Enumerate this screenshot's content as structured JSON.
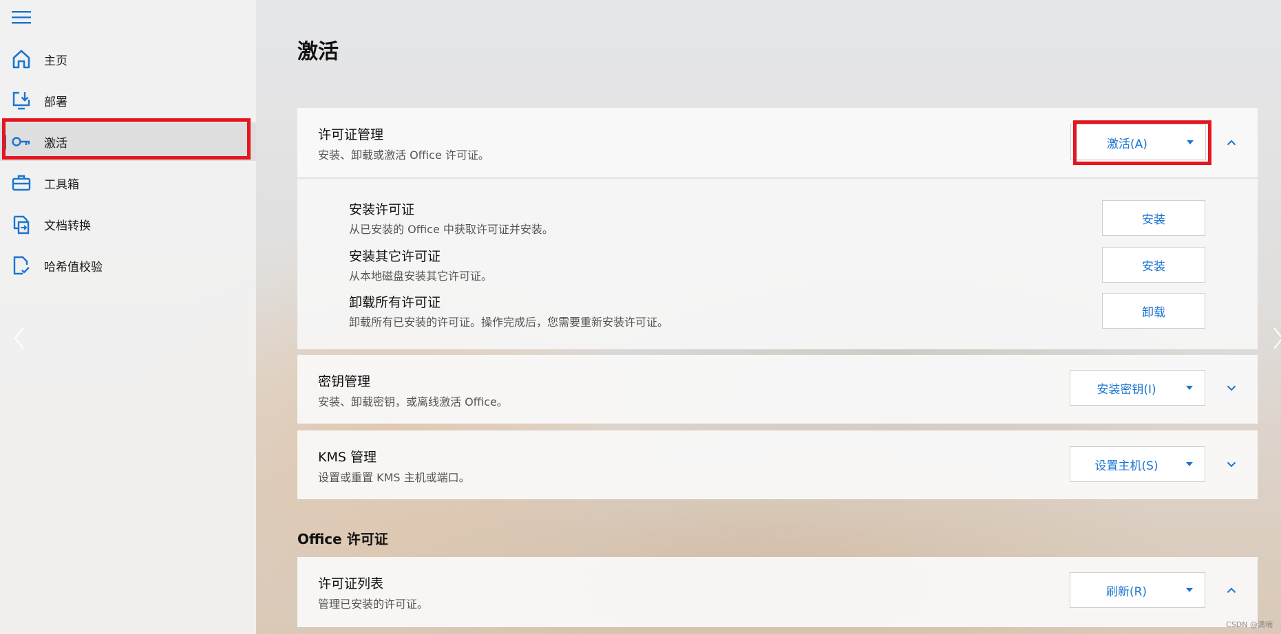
{
  "sidebar": {
    "items": [
      {
        "label": "主页",
        "icon": "home-icon"
      },
      {
        "label": "部署",
        "icon": "deploy-icon"
      },
      {
        "label": "激活",
        "icon": "key-icon",
        "selected": true
      },
      {
        "label": "工具箱",
        "icon": "toolbox-icon"
      },
      {
        "label": "文档转换",
        "icon": "document-convert-icon"
      },
      {
        "label": "哈希值校验",
        "icon": "hash-check-icon"
      }
    ]
  },
  "main": {
    "title": "激活",
    "license_management": {
      "title": "许可证管理",
      "desc": "安装、卸载或激活 Office 许可证。",
      "action_label": "激活(A)",
      "expanded": true,
      "items": [
        {
          "title": "安装许可证",
          "desc": "从已安装的 Office 中获取许可证并安装。",
          "button": "安装"
        },
        {
          "title": "安装其它许可证",
          "desc": "从本地磁盘安装其它许可证。",
          "button": "安装"
        },
        {
          "title": "卸载所有许可证",
          "desc": "卸载所有已安装的许可证。操作完成后，您需要重新安装许可证。",
          "button": "卸载"
        }
      ]
    },
    "key_management": {
      "title": "密钥管理",
      "desc": "安装、卸载密钥，或离线激活 Office。",
      "action_label": "安装密钥(I)",
      "expanded": false
    },
    "kms_management": {
      "title": "KMS 管理",
      "desc": "设置或重置 KMS 主机或端口。",
      "action_label": "设置主机(S)",
      "expanded": false
    },
    "office_license_heading": "Office 许可证",
    "license_list": {
      "title": "许可证列表",
      "desc": "管理已安装的许可证。",
      "action_label": "刷新(R)",
      "expanded": true
    }
  },
  "watermark": "CSDN @潇喃",
  "colors": {
    "accent": "#1a74d2",
    "highlight": "#e4151f"
  }
}
